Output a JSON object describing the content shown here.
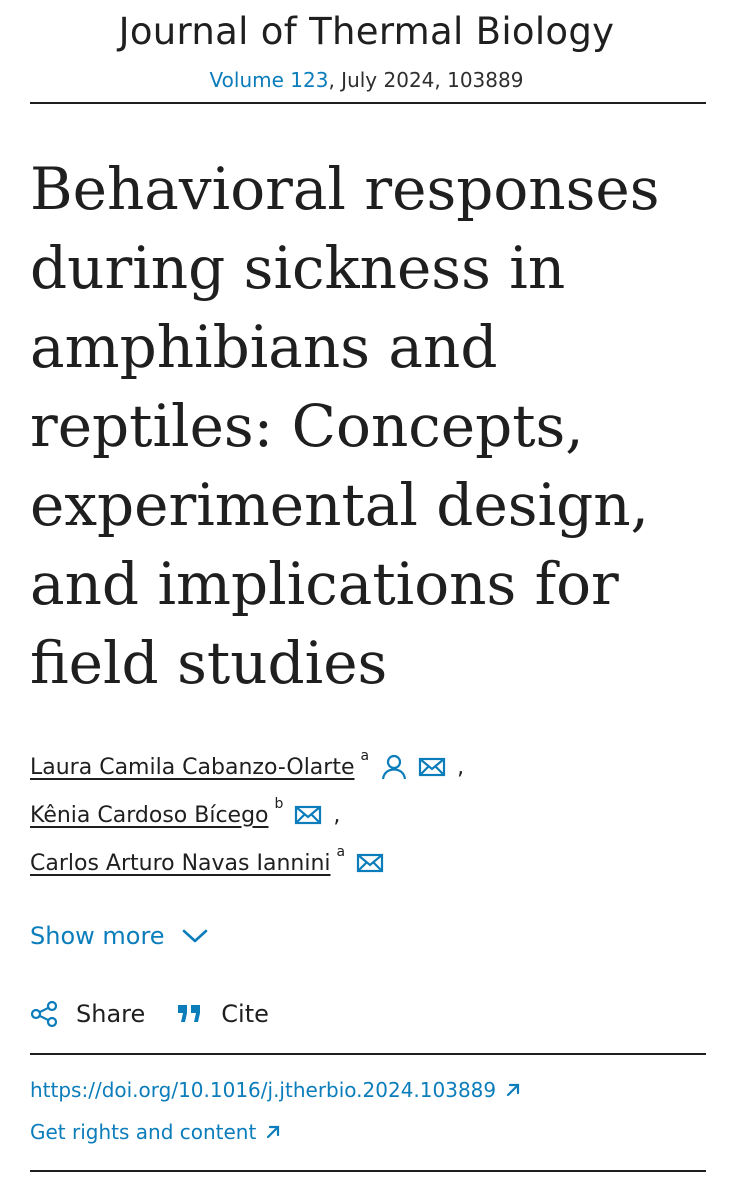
{
  "journal": {
    "name": "Journal of Thermal Biology",
    "volume_link": "Volume 123",
    "issue_rest": ", July 2024, 103889"
  },
  "article": {
    "title": "Behavioral responses during sickness in amphibians and reptiles: Concepts, experimental design, and implications for field studies"
  },
  "authors": [
    {
      "name": "Laura Camila Cabanzo-Olarte",
      "affiliation": "a",
      "icons": [
        "person-icon",
        "mail-icon"
      ],
      "separator": ","
    },
    {
      "name": "Kênia Cardoso Bícego",
      "affiliation": "b",
      "icons": [
        "mail-icon"
      ],
      "separator": ","
    },
    {
      "name": "Carlos Arturo Navas Iannini",
      "affiliation": "a",
      "icons": [
        "mail-icon"
      ],
      "separator": ""
    }
  ],
  "show_more_label": "Show more",
  "actions": {
    "share_label": "Share",
    "cite_label": "Cite"
  },
  "links": {
    "doi": "https://doi.org/10.1016/j.jtherbio.2024.103889",
    "rights": "Get rights and content"
  },
  "colors": {
    "link": "#0c7dbb",
    "text": "#1f1f1f"
  }
}
